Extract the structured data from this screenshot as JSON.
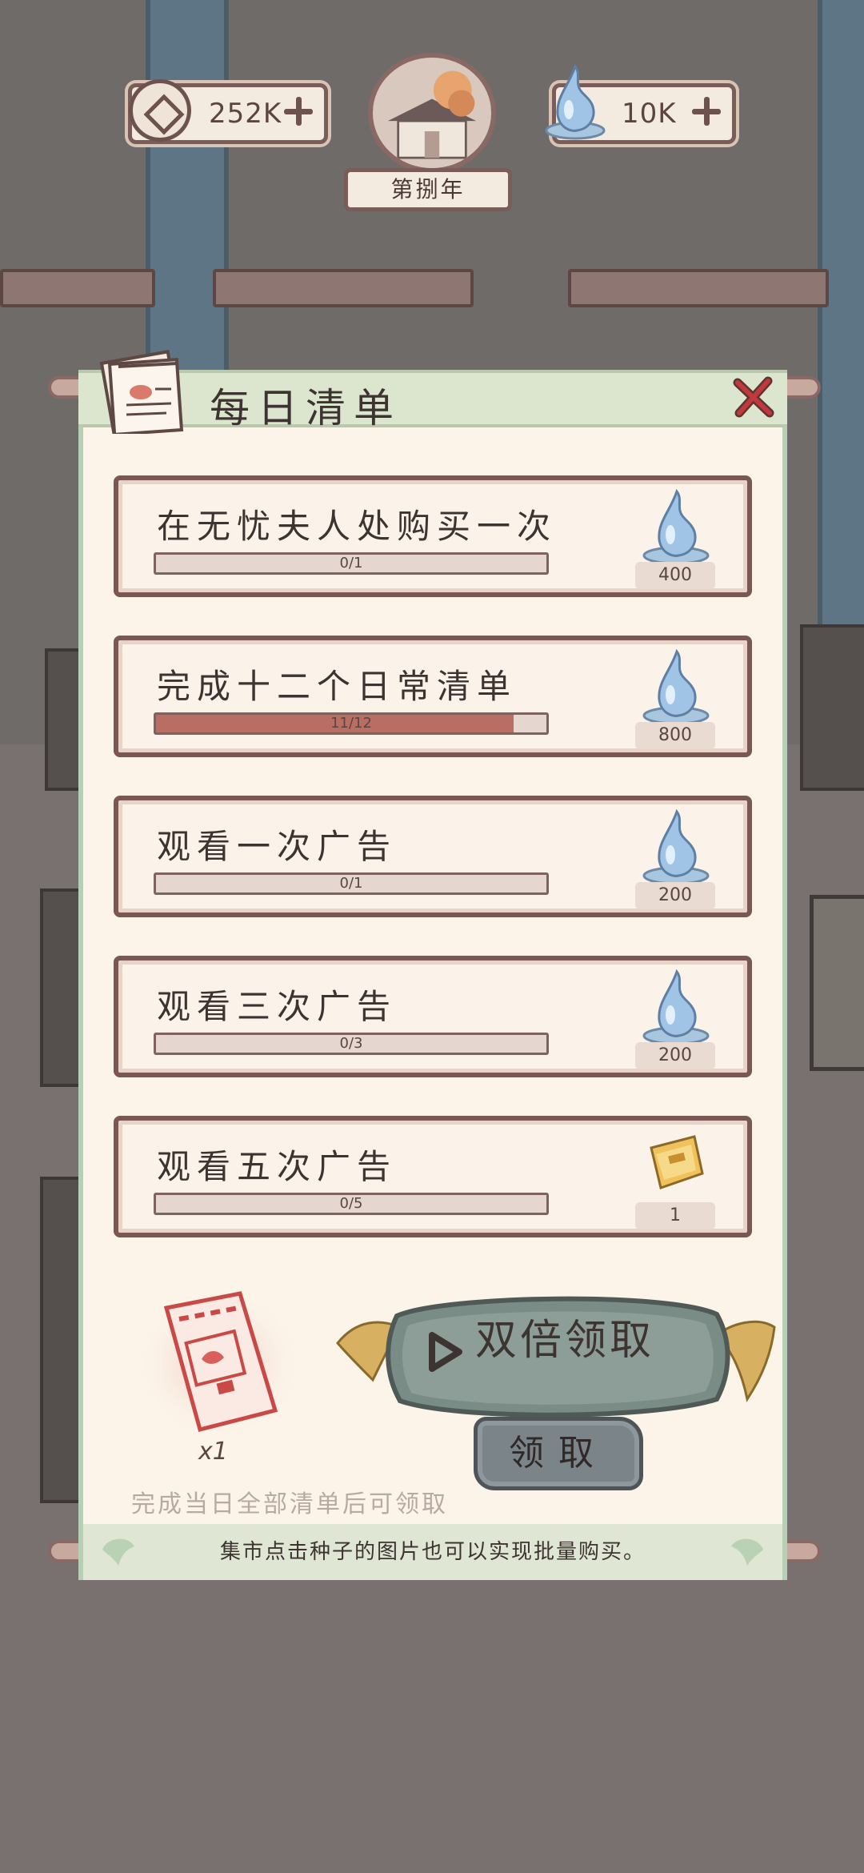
{
  "hud": {
    "coins_value": "252K",
    "drops_value": "10K",
    "year_label": "第捌年"
  },
  "panel": {
    "title": "每日清单",
    "tasks": [
      {
        "title": "在无忧夫人处购买一次",
        "progress_text": "0/1",
        "progress_fraction": 0,
        "reward_icon": "water-drop-icon",
        "reward_amount": "400"
      },
      {
        "title": "完成十二个日常清单",
        "progress_text": "11/12",
        "progress_fraction": 0.9167,
        "reward_icon": "water-drop-icon",
        "reward_amount": "800"
      },
      {
        "title": "观看一次广告",
        "progress_text": "0/1",
        "progress_fraction": 0,
        "reward_icon": "water-drop-icon",
        "reward_amount": "200"
      },
      {
        "title": "观看三次广告",
        "progress_text": "0/3",
        "progress_fraction": 0,
        "reward_icon": "water-drop-icon",
        "reward_amount": "200"
      },
      {
        "title": "观看五次广告",
        "progress_text": "0/5",
        "progress_fraction": 0,
        "reward_icon": "gold-ticket-icon",
        "reward_amount": "1"
      }
    ],
    "ticket_count": "x1",
    "double_claim_label": "双倍领取",
    "claim_label": "领取",
    "claim_hint": "完成当日全部清单后可领取",
    "footer_tip": "集市点击种子的图片也可以实现批量购买。"
  },
  "colors": {
    "progress_fill": "#b86e63",
    "panel_bg": "#fcf4e9",
    "header_green": "#dce6ce",
    "close_red": "#c0393b"
  }
}
